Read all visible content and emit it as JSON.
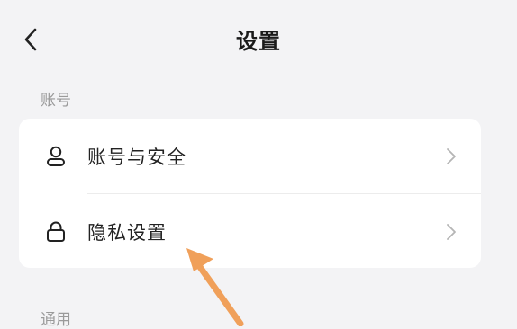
{
  "header": {
    "title": "设置"
  },
  "sections": {
    "account_label": "账号",
    "general_label": "通用"
  },
  "account_items": [
    {
      "label": "账号与安全",
      "icon": "user-icon"
    },
    {
      "label": "隐私设置",
      "icon": "lock-icon"
    }
  ],
  "annotation": {
    "arrow_color": "#f0a05a",
    "arrow_target": "隐私设置"
  }
}
